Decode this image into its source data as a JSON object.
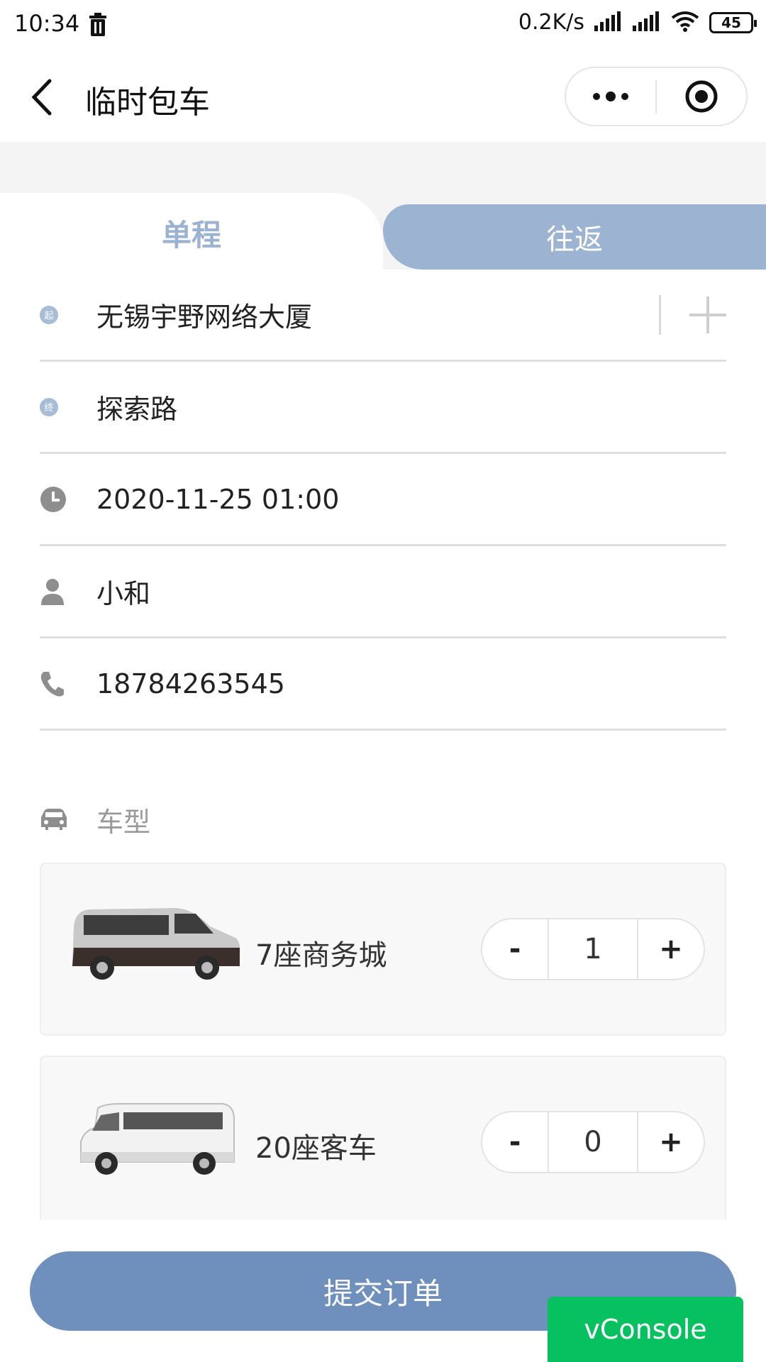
{
  "status_bar": {
    "time": "10:34",
    "network_speed": "0.2K/s",
    "battery": "45"
  },
  "navbar": {
    "title": "临时包车"
  },
  "tabs": {
    "single": "单程",
    "round_trip": "往返"
  },
  "form": {
    "start_marker": "起",
    "end_marker": "终",
    "start": "无锡宇野网络大厦",
    "end": "探索路",
    "datetime": "2020-11-25 01:00",
    "name": "小和",
    "phone": "18784263545",
    "car_type_label": "车型"
  },
  "cars": [
    {
      "name": "7座商务城",
      "count": "1"
    },
    {
      "name": "20座客车",
      "count": "0"
    }
  ],
  "stepper": {
    "minus": "-",
    "plus": "+"
  },
  "actions": {
    "submit": "提交订单",
    "vconsole": "vConsole"
  },
  "colors": {
    "accent": "#6f8fbd",
    "tab_inactive": "#9cb4d1",
    "vconsole": "#07c160"
  }
}
